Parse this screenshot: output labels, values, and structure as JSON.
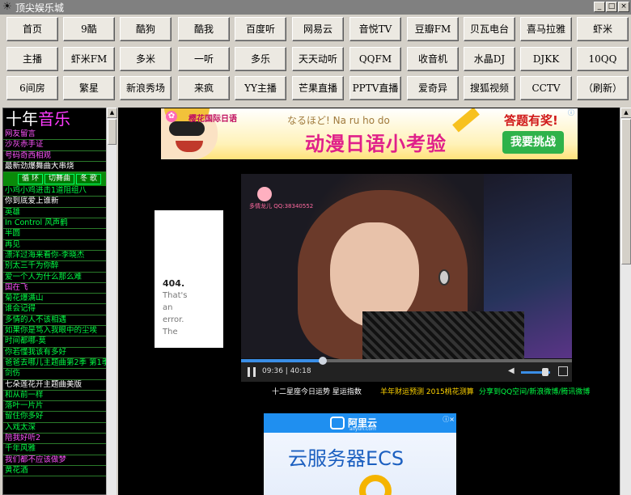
{
  "window": {
    "title": "顶尖娱乐城",
    "minimize": "_",
    "restore": "□",
    "close": "×"
  },
  "nav": {
    "rows": [
      [
        "首页",
        "9酷",
        "酷狗",
        "酷我",
        "百度听",
        "网易云",
        "音悦TV",
        "豆瓣FM",
        "贝瓦电台",
        "喜马拉雅",
        "虾米"
      ],
      [
        "主播",
        "虾米FM",
        "多米",
        "一听",
        "多乐",
        "天天动听",
        "QQFM",
        "收音机",
        "水晶DJ",
        "DJKK",
        "10QQ"
      ],
      [
        "6间房",
        "繁星",
        "新浪秀场",
        "来疯",
        "YY主播",
        "芒果直播",
        "PPTV直播",
        "爱奇异",
        "搜狐视频",
        "CCTV",
        "（刷新）"
      ]
    ]
  },
  "left_panel": {
    "title_a": "十年",
    "title_b": "音乐",
    "items_top": [
      {
        "text": "网友留言",
        "color": "#ff55ff"
      },
      {
        "text": "沙灰赤手证",
        "color": "#ff55ff"
      },
      {
        "text": "号码奇西相观",
        "color": "#ff55ff"
      },
      {
        "text": "最新劲爆舞曲大串烧",
        "color": "#ffffff"
      }
    ],
    "buttons": [
      "循 环",
      "切舞曲",
      "冬 歌"
    ],
    "items": [
      {
        "text": "小鸡小鸡进击1道阻组八",
        "color": "#00ff44"
      },
      {
        "text": "你到底爱上谁新",
        "color": "#ffffff"
      },
      {
        "text": "英雄",
        "color": "#00ff44"
      },
      {
        "text": "In Control 风声鹤",
        "color": "#00ff44"
      },
      {
        "text": "半圆",
        "color": "#00ff44"
      },
      {
        "text": "再见",
        "color": "#00ff44"
      },
      {
        "text": "漂洋过海来看你-李晓杰",
        "color": "#00ff44"
      },
      {
        "text": "别太三千为你醉",
        "color": "#00ff44"
      },
      {
        "text": "爱一个人为什么那么难",
        "color": "#00ff44"
      },
      {
        "text": "国在飞",
        "color": "#ff55ff"
      },
      {
        "text": "菊花爆满山",
        "color": "#00ff44"
      },
      {
        "text": "谁会记得",
        "color": "#00ff44"
      },
      {
        "text": "多情的人不该相遇",
        "color": "#00ff44"
      },
      {
        "text": "如果你是笃入我眼中的尘埃",
        "color": "#00ff44"
      },
      {
        "text": "时间都哪-莫",
        "color": "#00ff44"
      },
      {
        "text": "你若懂我该有多好",
        "color": "#00ff44"
      },
      {
        "text": "爸爸去哪儿主题曲第2季 第1季",
        "color": "#00ff44"
      },
      {
        "text": "剑伤",
        "color": "#00ff44"
      },
      {
        "text": "七朵莲花开主题曲美版",
        "color": "#ffffff"
      },
      {
        "text": "和从前一样",
        "color": "#00ff44"
      },
      {
        "text": "落叶一片片",
        "color": "#00ff44"
      },
      {
        "text": "留住你多好",
        "color": "#00ff44"
      },
      {
        "text": "入戏太深",
        "color": "#00ff44"
      },
      {
        "text": "陪我好听2",
        "color": "#ff55ff"
      },
      {
        "text": "千年风雅",
        "color": "#00ff44"
      },
      {
        "text": "我们都不应该做梦",
        "color": "#ff55ff"
      },
      {
        "text": "黄花酒",
        "color": "#00ff44"
      }
    ]
  },
  "banner_ad": {
    "brand": "樱花国际日语",
    "ruby": "なるほど! Na ru ho do",
    "headline": "动漫日语小考验",
    "prize": "答题有奖!",
    "button": "我要挑战",
    "close": "ⓘ"
  },
  "error_box": {
    "code": "404.",
    "message": "That's an error. The"
  },
  "video": {
    "watermark": "多情龙儿 QQ:38340552",
    "time": "09:36 | 40:18",
    "progress": 0.24,
    "volume": 0.8
  },
  "links": {
    "a": "十二星座今日运势 星运指数",
    "b": "羊年财运预测 2015桃花测算",
    "c": "分享到QQ空间/新浪微博/腾讯微博"
  },
  "cloud_ad": {
    "logo": "阿里云",
    "logosub": "aliyun.com",
    "headline": "云服务器ECS",
    "close": "ⓘ×"
  },
  "colors": {
    "accent_green": "#00ff44",
    "accent_pink": "#ff55ff",
    "bar": "#3a8ee6"
  }
}
